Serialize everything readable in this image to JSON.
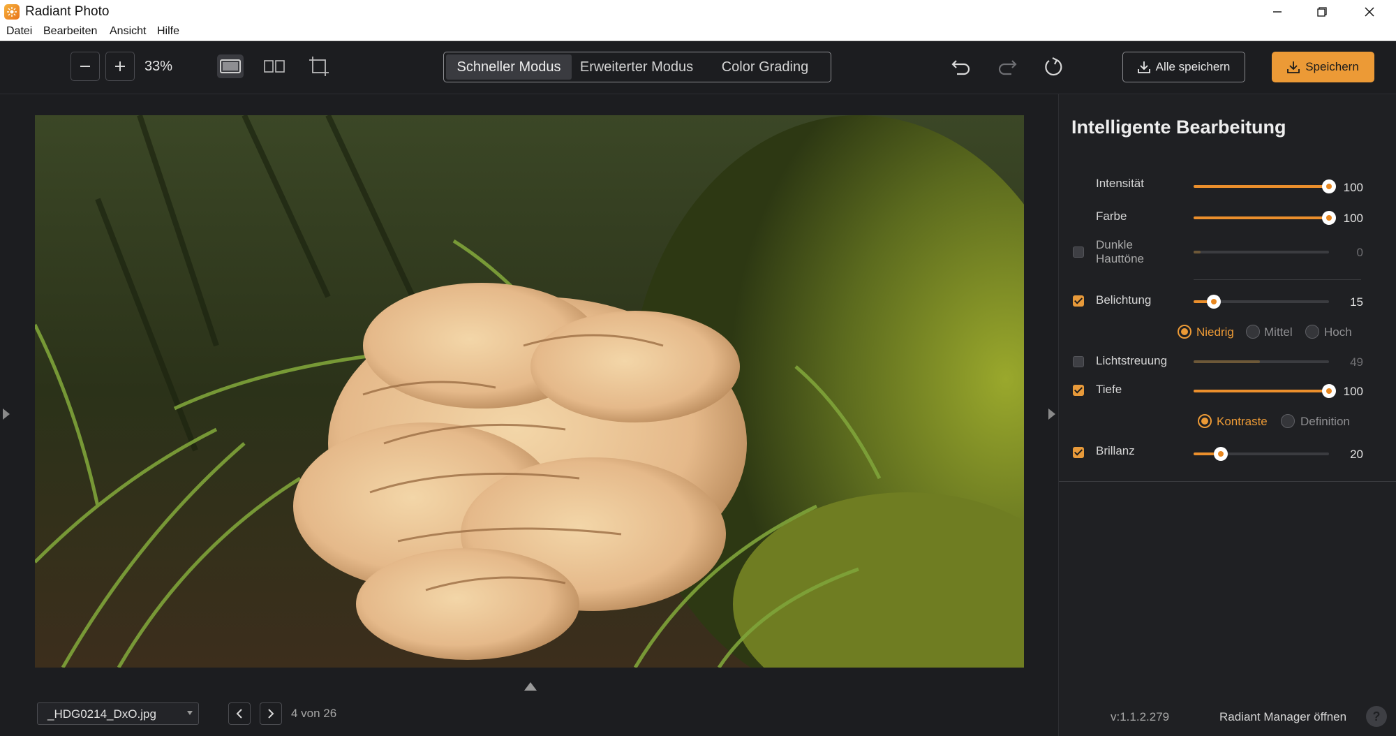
{
  "window": {
    "title": "Radiant Photo",
    "minimize_icon": "minimize-icon",
    "maximize_icon": "restore-icon",
    "close_icon": "close-icon"
  },
  "menu": {
    "items": [
      "Datei",
      "Bearbeiten",
      "Ansicht",
      "Hilfe"
    ]
  },
  "toolbar": {
    "zoom_out_icon": "minus-icon",
    "zoom_in_icon": "plus-icon",
    "zoom_level": "33%",
    "view_modes": [
      "single-view-icon",
      "split-view-icon",
      "crop-view-icon"
    ],
    "mode_tabs": [
      {
        "label": "Schneller Modus",
        "active": true
      },
      {
        "label": "Erweiterter Modus",
        "active": false
      },
      {
        "label": "Color Grading",
        "active": false
      }
    ],
    "undo_icon": "undo-icon",
    "redo_icon": "redo-icon",
    "reset_icon": "reset-icon",
    "save_all_label": "Alle speichern",
    "save_label": "Speichern"
  },
  "canvas": {
    "image_content": "photo of cream-colored bracket fungus on mossy forest floor with grass",
    "file_name": "_HDG0214_DxO.jpg",
    "counter": "4 von 26"
  },
  "panel": {
    "title": "Intelligente Bearbeitung",
    "params": [
      {
        "label": "Intensität",
        "has_checkbox": false,
        "value": "100",
        "fraction": 1.0,
        "enabled": true
      },
      {
        "label": "Farbe",
        "has_checkbox": false,
        "value": "100",
        "fraction": 1.0,
        "enabled": true
      },
      {
        "label": "Dunkle Hauttöne",
        "has_checkbox": true,
        "checked": false,
        "value": "0",
        "fraction": 0.0,
        "enabled": false
      },
      {
        "label": "Belichtung",
        "has_checkbox": true,
        "checked": true,
        "value": "15",
        "fraction": 0.15,
        "enabled": true
      },
      {
        "label": "Lichtstreuung",
        "has_checkbox": true,
        "checked": false,
        "value": "49",
        "fraction": 0.49,
        "enabled": false
      },
      {
        "label": "Tiefe",
        "has_checkbox": true,
        "checked": true,
        "value": "100",
        "fraction": 1.0,
        "enabled": true
      },
      {
        "label": "Brillanz",
        "has_checkbox": true,
        "checked": true,
        "value": "20",
        "fraction": 0.2,
        "enabled": true
      }
    ],
    "exposure_options": [
      {
        "label": "Niedrig",
        "selected": true
      },
      {
        "label": "Mittel",
        "selected": false
      },
      {
        "label": "Hoch",
        "selected": false
      }
    ],
    "depth_options": [
      {
        "label": "Kontraste",
        "selected": true
      },
      {
        "label": "Definition",
        "selected": false
      }
    ],
    "version": "v:1.1.2.279",
    "manager_link": "Radiant Manager öffnen",
    "help_label": "?"
  },
  "colors": {
    "accent": "#ec9a36",
    "background": "#1c1d20",
    "panel": "#1f2023"
  }
}
